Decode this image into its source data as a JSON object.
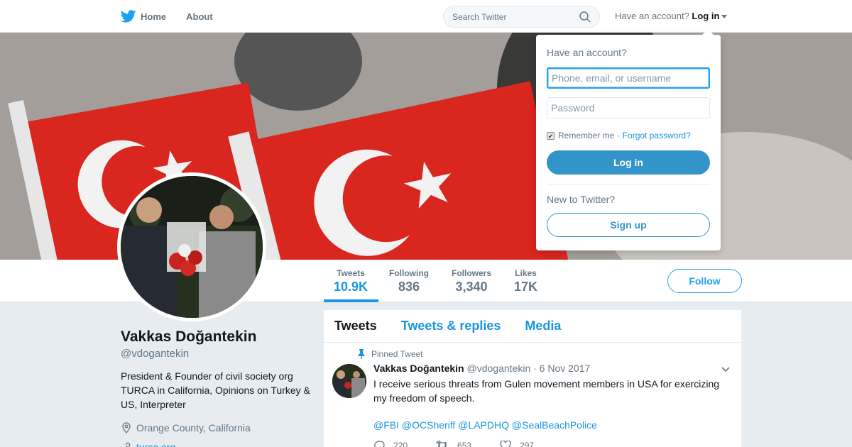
{
  "nav": {
    "home_label": "Home",
    "about_label": "About",
    "search_placeholder": "Search Twitter",
    "account_prompt": "Have an account?",
    "login_label": "Log in"
  },
  "profile": {
    "name": "Vakkas Doğantekin",
    "handle": "@vdogantekin",
    "bio": "President & Founder of civil society org TURCA in California, Opinions on Turkey & US, Interpreter",
    "location": "Orange County, California",
    "url": "turca.org"
  },
  "stats": [
    {
      "label": "Tweets",
      "value": "10.9K"
    },
    {
      "label": "Following",
      "value": "836"
    },
    {
      "label": "Followers",
      "value": "3,340"
    },
    {
      "label": "Likes",
      "value": "17K"
    }
  ],
  "follow_label": "Follow",
  "timeline": {
    "tabs": [
      "Tweets",
      "Tweets & replies",
      "Media"
    ],
    "pinned_label": "Pinned Tweet",
    "tweet": {
      "name": "Vakkas Doğantekin",
      "handle": "@vdogantekin",
      "date": "· 6 Nov 2017",
      "text": "I receive serious threats from Gulen movement members in USA for exercizing my freedom of speech.",
      "mentions": [
        "@FBI",
        "@OCSheriff",
        "@LAPDHQ",
        "@SealBeachPolice"
      ],
      "replies": "220",
      "retweets": "653",
      "likes": "297"
    }
  },
  "login_dropdown": {
    "title": "Have an account?",
    "username_placeholder": "Phone, email, or username",
    "password_placeholder": "Password",
    "remember_label": "Remember me",
    "forgot_label": "Forgot password?",
    "login_button": "Log in",
    "new_prompt": "New to Twitter?",
    "signup_button": "Sign up"
  },
  "colors": {
    "accent": "#1da1f2",
    "link": "#1b95e0",
    "login_button": "#3294c8",
    "flag_red": "#d9261f"
  }
}
